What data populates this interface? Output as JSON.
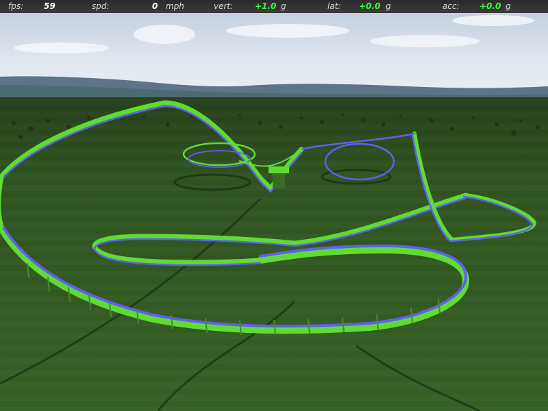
{
  "hud": {
    "fps_label": "fps:",
    "fps_value": "59",
    "spd_label": "spd:",
    "spd_value": "0",
    "spd_unit": "mph",
    "vert_label": "vert:",
    "vert_value": "+1.0",
    "vert_unit": "g",
    "lat_label": "lat:",
    "lat_value": "+0.0",
    "lat_unit": "g",
    "acc_label": "acc:",
    "acc_value": "+0.0",
    "acc_unit": "g"
  },
  "colors": {
    "track_rail": "#5f5ff2",
    "track_spine": "#5fdc32",
    "grass": "#2f5a1d",
    "hud_value": "#39ff39"
  }
}
